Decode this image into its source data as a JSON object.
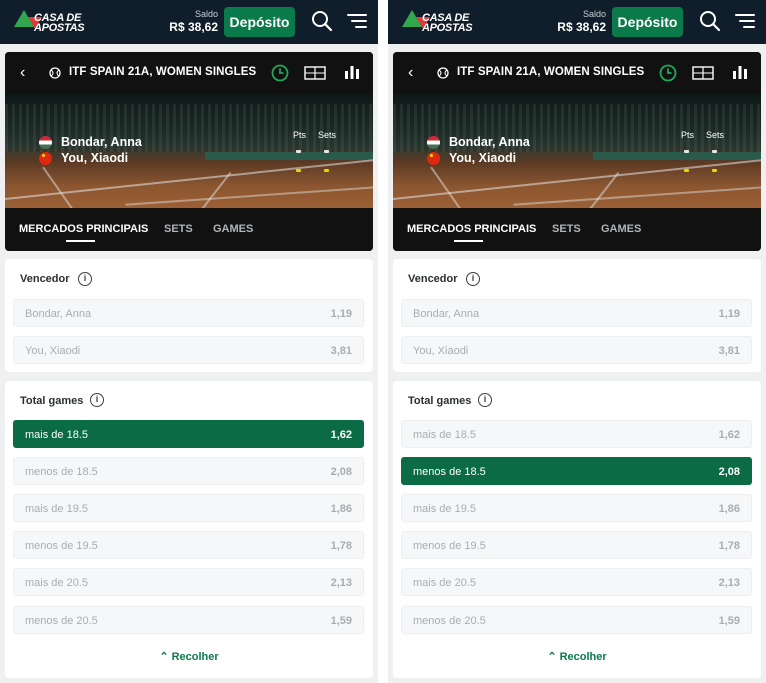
{
  "header": {
    "logo_text_line1": "CASA DE",
    "logo_text_line2": "APOSTAS",
    "saldo_label": "Saldo",
    "saldo_value": "R$ 38,62",
    "deposit_label": "Depósito"
  },
  "event": {
    "title": "ITF SPAIN 21A, WOMEN SINGLES",
    "score_headers": {
      "pts": "Pts",
      "sets": "Sets"
    },
    "players": [
      {
        "name": "Bondar, Anna",
        "flag": "hungary-flag"
      },
      {
        "name": "You, Xiaodi",
        "flag": "china-flag"
      }
    ]
  },
  "tabs": [
    {
      "label": "MERCADOS PRINCIPAIS",
      "active": true
    },
    {
      "label": "SETS",
      "active": false
    },
    {
      "label": "GAMES",
      "active": false
    }
  ],
  "markets": {
    "winner": {
      "title": "Vencedor",
      "odds": [
        {
          "label": "Bondar, Anna",
          "value": "1,19"
        },
        {
          "label": "You, Xiaodi",
          "value": "3,81"
        }
      ]
    },
    "total_games": {
      "title": "Total games",
      "odds": [
        {
          "label": "mais de 18.5",
          "value": "1,62"
        },
        {
          "label": "menos de 18.5",
          "value": "2,08"
        },
        {
          "label": "mais de 19.5",
          "value": "1,86"
        },
        {
          "label": "menos de 19.5",
          "value": "1,78"
        },
        {
          "label": "mais de 20.5",
          "value": "2,13"
        },
        {
          "label": "menos de 20.5",
          "value": "1,59"
        }
      ],
      "collapse_label": "Recolher"
    }
  },
  "panels": [
    {
      "selected_total_index": 0
    },
    {
      "selected_total_index": 1
    }
  ],
  "colors": {
    "topbar": "#0f1e2a",
    "brand_green": "#0b7a4b",
    "selected_green": "#0b6b45"
  }
}
